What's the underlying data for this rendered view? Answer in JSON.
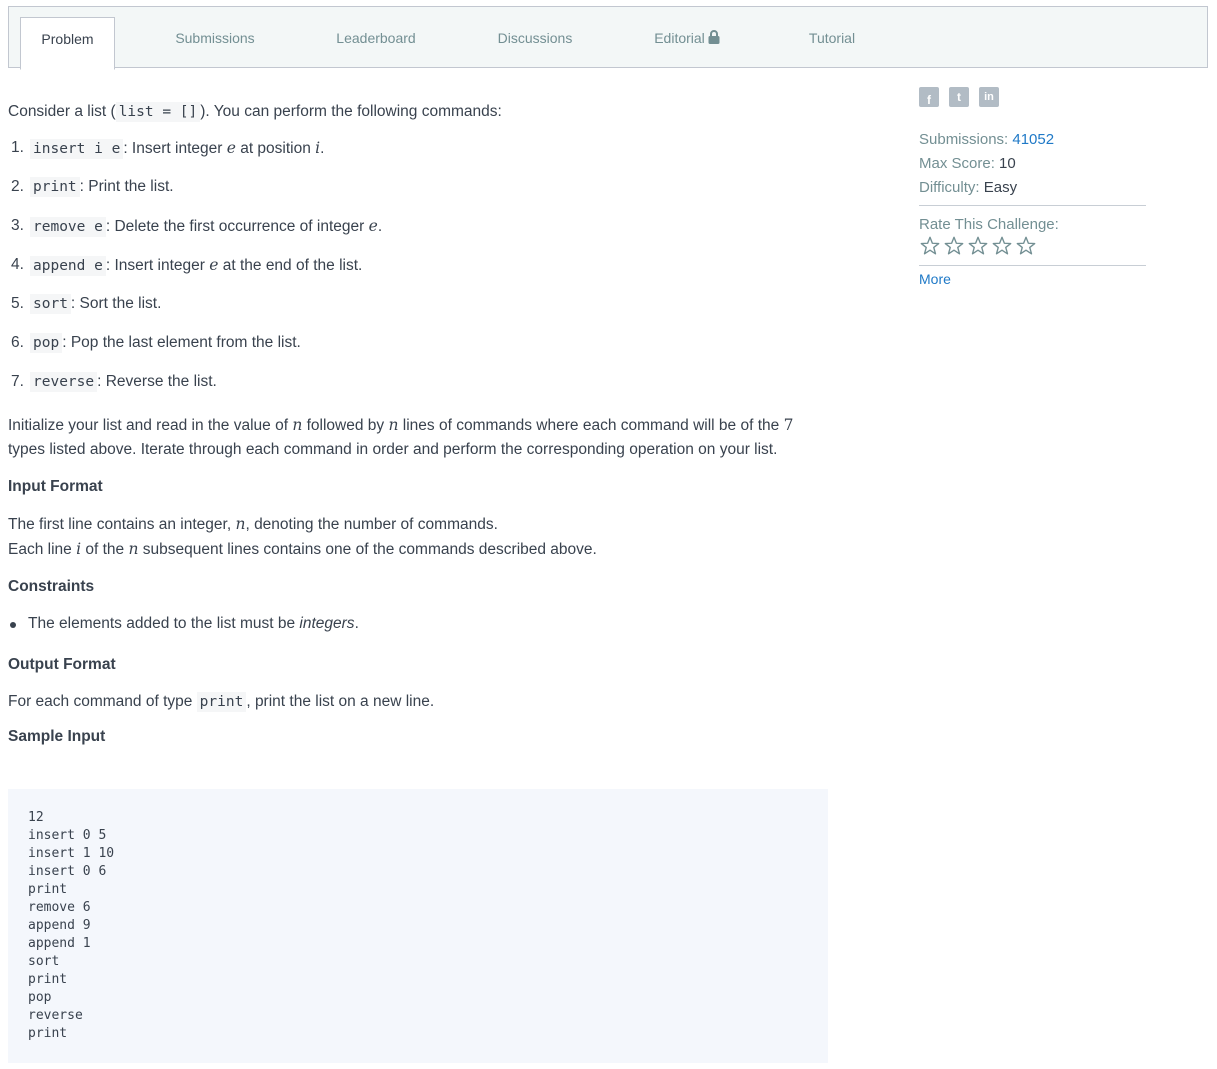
{
  "tabs": {
    "problem": "Problem",
    "submissions": "Submissions",
    "leaderboard": "Leaderboard",
    "discussions": "Discussions",
    "editorial": "Editorial",
    "tutorial": "Tutorial"
  },
  "intro": {
    "before": "Consider a list (",
    "code": "list = []",
    "after": "). You can perform the following commands:"
  },
  "commands": [
    {
      "num": "1.",
      "code": "insert i e",
      "sep": ":",
      "before": " Insert integer ",
      "var": "e",
      "mid": " at position ",
      "var2": "i",
      "after": "."
    },
    {
      "num": "2.",
      "code": "print",
      "sep": ":",
      "before": " Print the list."
    },
    {
      "num": "3.",
      "code": "remove e",
      "sep": ":",
      "before": " Delete the first occurrence of integer ",
      "var": "e",
      "after": "."
    },
    {
      "num": "4.",
      "code": "append e",
      "sep": ":",
      "before": " Insert integer ",
      "var": "e",
      "after": " at the end of the list."
    },
    {
      "num": "5.",
      "code": "sort",
      "sep": ":",
      "before": " Sort the list."
    },
    {
      "num": "6.",
      "code": "pop",
      "sep": ":",
      "before": " Pop the last element from the list."
    },
    {
      "num": "7.",
      "code": "reverse",
      "sep": ":",
      "before": " Reverse the list."
    }
  ],
  "init": {
    "p1": "Initialize your list and read in the value of ",
    "n": "n",
    "p2": " followed by ",
    "n2": "n",
    "p3": " lines of commands where each command will be of the ",
    "seven": "7",
    "p4": " types listed above. Iterate through each command in order and perform the corresponding operation on your list."
  },
  "input_format": {
    "heading": "Input Format",
    "l1a": "The first line contains an integer, ",
    "l1n": "n",
    "l1b": ", denoting the number of commands.",
    "l2a": "Each line ",
    "l2i": "i",
    "l2b": " of the ",
    "l2n": "n",
    "l2c": " subsequent lines contains one of the commands described above."
  },
  "constraints": {
    "heading": "Constraints",
    "item_before": "The elements added to the list must be ",
    "item_em": "integers",
    "item_after": "."
  },
  "output_format": {
    "heading": "Output Format",
    "before": "For each command of type ",
    "code": "print",
    "after": ", print the list on a new line."
  },
  "sample_input": {
    "heading": "Sample Input",
    "text": "12\ninsert 0 5\ninsert 1 10\ninsert 0 6\nprint\nremove 6\nappend 9\nappend 1\nsort\nprint\npop\nreverse\nprint"
  },
  "sidebar": {
    "social": {
      "facebook": "f",
      "twitter": "t",
      "linkedin": "in"
    },
    "submissions_label": "Submissions:",
    "submissions_value": "41052",
    "max_score_label": "Max Score:",
    "max_score_value": "10",
    "difficulty_label": "Difficulty:",
    "difficulty_value": "Easy",
    "rate_label": "Rate This Challenge:",
    "star_count": 5,
    "more": "More"
  },
  "colors": {
    "link": "#1f79c7",
    "muted": "#738f93",
    "text": "#39424e",
    "tab_bg": "#f3f7f7",
    "code_bg": "#f4f7fc"
  }
}
